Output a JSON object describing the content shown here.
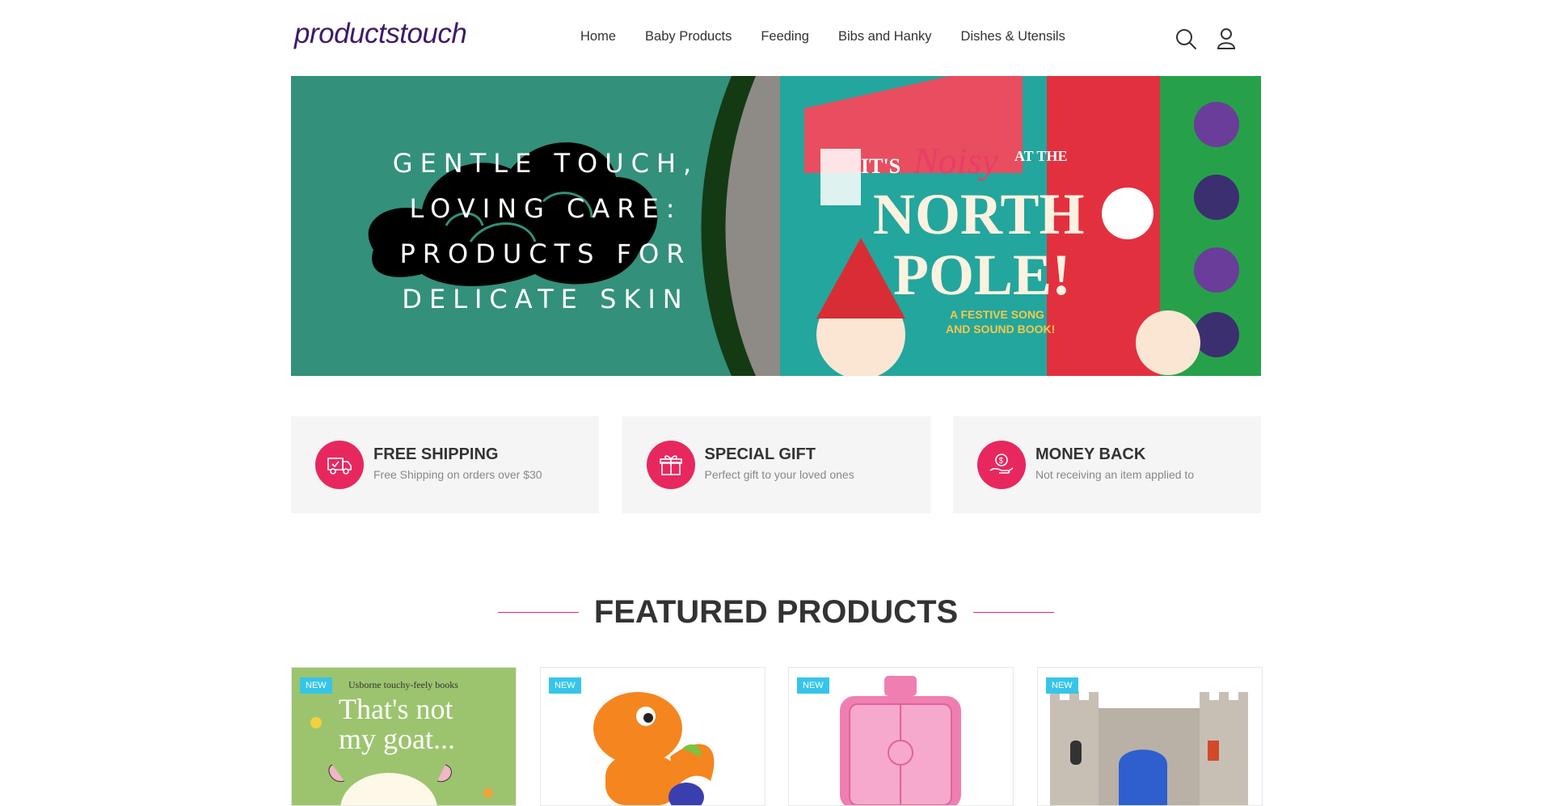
{
  "brand": {
    "logo": "productstouch"
  },
  "nav": {
    "items": [
      "Home",
      "Baby Products",
      "Feeding",
      "Bibs and Hanky",
      "Dishes & Utensils"
    ]
  },
  "header_icons": [
    "search-icon",
    "user-icon"
  ],
  "banner": {
    "headline_lines": [
      "GENTLE TOUCH,",
      "LOVING CARE:",
      "PRODUCTS FOR",
      "DELICATE SKIN"
    ],
    "book_text": {
      "line1": "IT'S",
      "line2": "Noisy",
      "line3": "AT THE",
      "line4": "NORTH",
      "line5": "POLE!",
      "line6": "A FESTIVE SONG",
      "line7": "AND SOUND BOOK!"
    }
  },
  "features": [
    {
      "icon": "truck-icon",
      "title": "FREE SHIPPING",
      "subtitle": "Free Shipping on orders over $30"
    },
    {
      "icon": "gift-icon",
      "title": "SPECIAL GIFT",
      "subtitle": "Perfect gift to your loved ones"
    },
    {
      "icon": "money-hand-icon",
      "title": "MONEY BACK",
      "subtitle": "Not receiving an item applied to"
    }
  ],
  "featured": {
    "title": "FEATURED PRODUCTS",
    "products": [
      {
        "badge": "NEW",
        "book_series": "Usborne touchy-feely books",
        "book_title_1": "That's not",
        "book_title_2": "my goat..."
      },
      {
        "badge": "NEW"
      },
      {
        "badge": "NEW"
      },
      {
        "badge": "NEW"
      }
    ]
  },
  "colors": {
    "accent": "#e8275f",
    "badge": "#36c5e9",
    "banner_bg": "#33907a",
    "logo": "#3d1a6b"
  }
}
